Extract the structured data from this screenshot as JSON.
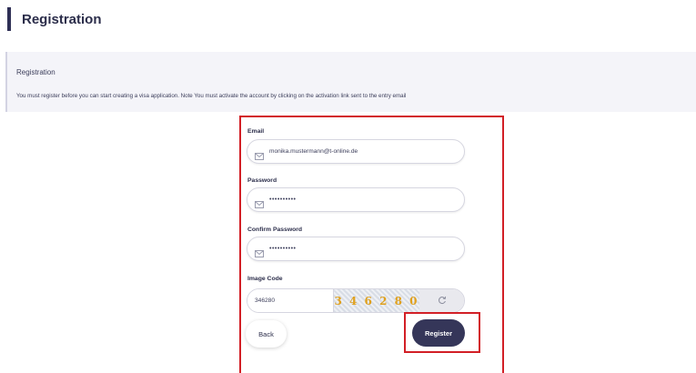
{
  "header": {
    "title": "Registration"
  },
  "info": {
    "title": "Registration",
    "text": "You must register before you can start creating a visa application. Note You must activate the account by clicking on the activation link sent to the entry email"
  },
  "form": {
    "email": {
      "label": "Email",
      "value": "monika.mustermann@t-online.de",
      "icon": "envelope-icon"
    },
    "password": {
      "label": "Password",
      "value": "••••••••••",
      "icon": "envelope-icon"
    },
    "confirm_password": {
      "label": "Confirm Password",
      "value": "••••••••••",
      "icon": "envelope-icon"
    },
    "image_code": {
      "label": "Image Code",
      "value": "346280",
      "captcha_text": "3 4 6 2 8 0",
      "refresh_icon": "refresh-icon"
    },
    "back_label": "Back",
    "register_label": "Register"
  },
  "colors": {
    "accent": "#353659",
    "highlight": "#d21f26",
    "panel": "#f4f4f9"
  }
}
